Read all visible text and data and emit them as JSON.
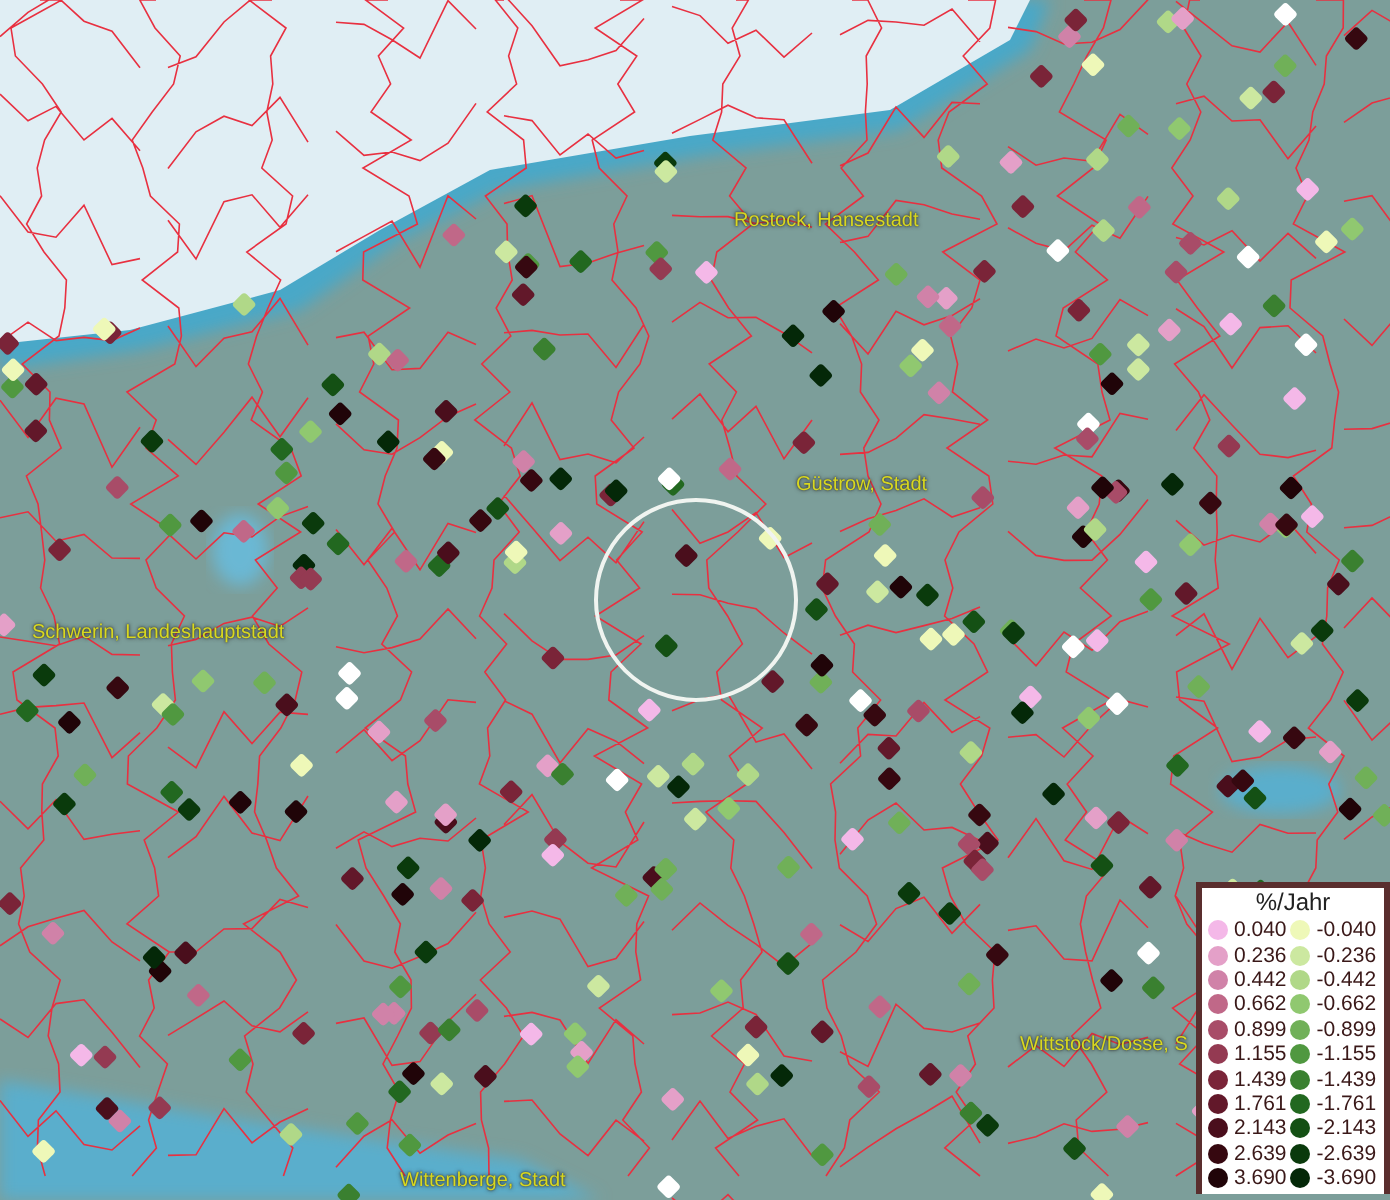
{
  "map": {
    "place_labels": [
      {
        "label": "Rostock, Hansestadt",
        "kind": "city"
      },
      {
        "label": "Güstrow, Stadt",
        "kind": "city"
      },
      {
        "label": "Schwerin, Landeshauptstadt",
        "kind": "city"
      },
      {
        "label": "Wittstock/Dosse, S",
        "kind": "city"
      },
      {
        "label": "Wittenberge, Stadt",
        "kind": "city"
      }
    ]
  },
  "legend": {
    "title": "%/Jahr",
    "columns": [
      [
        {
          "label": "0.040",
          "color": "#f4b8e8"
        },
        {
          "label": "0.236",
          "color": "#e4a0c8"
        },
        {
          "label": "0.442",
          "color": "#d082a8"
        },
        {
          "label": "0.662",
          "color": "#c06888"
        },
        {
          "label": "0.899",
          "color": "#a84c68"
        },
        {
          "label": "1.155",
          "color": "#943a52"
        },
        {
          "label": "1.439",
          "color": "#7a2438"
        },
        {
          "label": "1.761",
          "color": "#62182a"
        },
        {
          "label": "2.143",
          "color": "#4a0e1c"
        },
        {
          "label": "2.639",
          "color": "#360810"
        },
        {
          "label": "3.690",
          "color": "#200408"
        }
      ],
      [
        {
          "label": "-0.040",
          "color": "#eef8b8"
        },
        {
          "label": "-0.236",
          "color": "#cce8a0"
        },
        {
          "label": "-0.442",
          "color": "#b0d888"
        },
        {
          "label": "-0.662",
          "color": "#90c870"
        },
        {
          "label": "-0.899",
          "color": "#70b058"
        },
        {
          "label": "-1.155",
          "color": "#509840"
        },
        {
          "label": "-1.439",
          "color": "#3a8030"
        },
        {
          "label": "-1.761",
          "color": "#226820"
        },
        {
          "label": "-2.143",
          "color": "#145014"
        },
        {
          "label": "-2.639",
          "color": "#0a3a0c"
        },
        {
          "label": "-3.690",
          "color": "#042808"
        }
      ]
    ]
  }
}
